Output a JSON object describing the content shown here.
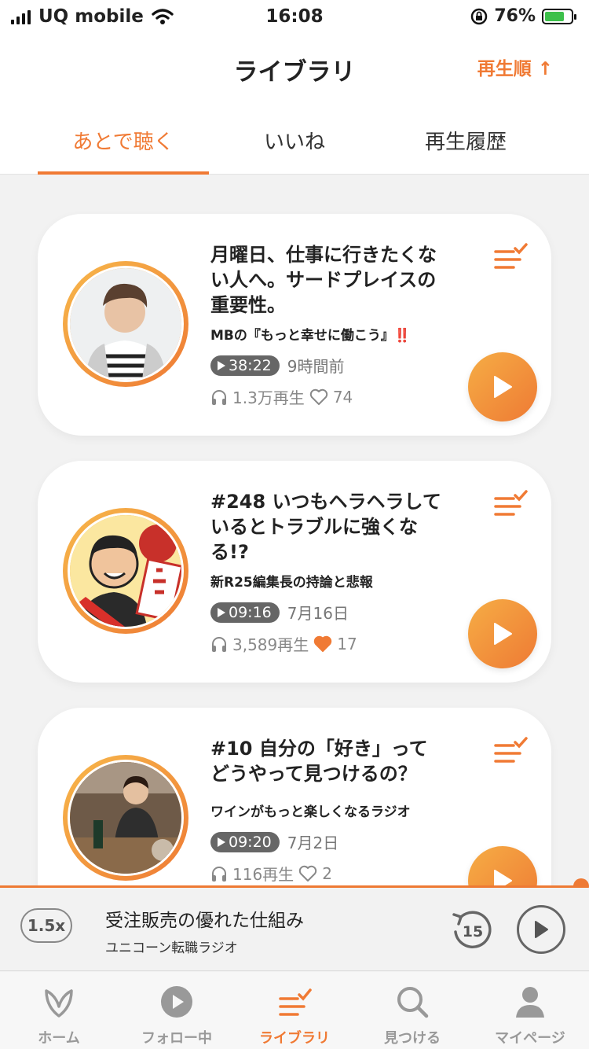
{
  "status_bar": {
    "carrier": "UQ mobile",
    "time": "16:08",
    "battery": "76%"
  },
  "header": {
    "title": "ライブラリ",
    "sort_label": "再生順 ↑"
  },
  "tabs": [
    {
      "label": "あとで聴く",
      "active": true
    },
    {
      "label": "いいね",
      "active": false
    },
    {
      "label": "再生履歴",
      "active": false
    }
  ],
  "episodes": [
    {
      "title": "月曜日、仕事に行きたくない人へ。サードプレイスの重要性。",
      "show": "MBの『もっと幸せに働こう』‼️",
      "duration": "38:22",
      "date": "9時間前",
      "plays": "1.3万再生",
      "likes": "74",
      "liked": false,
      "avatar_icon": "person-photo-icon"
    },
    {
      "title": "#248 いつもヘラヘラしているとトラブルに強くなる!?",
      "show": "新R25編集長の持論と悲報",
      "duration": "09:16",
      "date": "7月16日",
      "plays": "3,589再生",
      "likes": "17",
      "liked": true,
      "avatar_icon": "illustration-icon"
    },
    {
      "title": "#10 自分の「好き」ってどうやって見つけるの？",
      "show": "ワインがもっと楽しくなるラジオ",
      "duration": "09:20",
      "date": "7月2日",
      "plays": "116再生",
      "likes": "2",
      "liked": false,
      "avatar_icon": "person-photo-icon"
    }
  ],
  "mini_player": {
    "speed": "1.5x",
    "title": "受注販売の優れた仕組み",
    "show": "ユニコーン転職ラジオ",
    "skip": "15",
    "progress": 0.99
  },
  "nav": [
    {
      "label": "ホーム",
      "icon": "home-leaf-icon",
      "active": false
    },
    {
      "label": "フォロー中",
      "icon": "play-circle-icon",
      "active": false
    },
    {
      "label": "ライブラリ",
      "icon": "library-icon",
      "active": true
    },
    {
      "label": "見つける",
      "icon": "search-icon",
      "active": false
    },
    {
      "label": "マイページ",
      "icon": "user-icon",
      "active": false
    }
  ],
  "colors": {
    "accent": "#f07a34",
    "accent_light": "#f6ad45"
  }
}
